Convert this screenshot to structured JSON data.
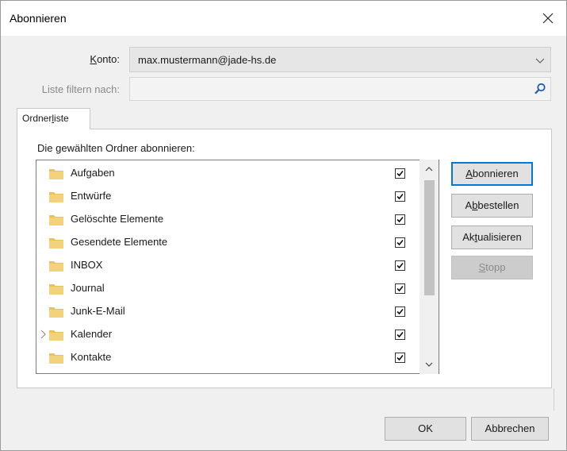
{
  "window": {
    "title": "Abonnieren",
    "close_icon": "close-icon"
  },
  "account": {
    "label_accel": "K",
    "label_rest": "onto:",
    "value": "max.mustermann@jade-hs.de"
  },
  "filter": {
    "label": "Liste filtern nach:",
    "value": "",
    "icon": "search-icon"
  },
  "tab": {
    "label_pre": "Ordner",
    "label_accel": "l",
    "label_post": "iste"
  },
  "folder_list": {
    "caption": "Die gewählten Ordner abonnieren:",
    "items": [
      {
        "name": "Aufgaben",
        "checked": true,
        "expandable": false
      },
      {
        "name": "Entwürfe",
        "checked": true,
        "expandable": false
      },
      {
        "name": "Gelöschte Elemente",
        "checked": true,
        "expandable": false
      },
      {
        "name": "Gesendete Elemente",
        "checked": true,
        "expandable": false
      },
      {
        "name": "INBOX",
        "checked": true,
        "expandable": false
      },
      {
        "name": "Journal",
        "checked": true,
        "expandable": false
      },
      {
        "name": "Junk-E-Mail",
        "checked": true,
        "expandable": false
      },
      {
        "name": "Kalender",
        "checked": true,
        "expandable": true
      },
      {
        "name": "Kontakte",
        "checked": true,
        "expandable": false
      }
    ]
  },
  "side_buttons": {
    "subscribe": {
      "accel": "A",
      "rest": "bonnieren"
    },
    "unsubscribe": {
      "pre": "A",
      "accel": "b",
      "rest": "bestellen"
    },
    "refresh": {
      "pre": "Ak",
      "accel": "t",
      "rest": "ualisieren"
    },
    "stop": {
      "accel": "S",
      "rest": "topp",
      "disabled": true
    }
  },
  "footer": {
    "ok_label": "OK",
    "cancel_label": "Abbrechen"
  },
  "colors": {
    "accent": "#0078d7",
    "folder": "#e8c35a",
    "dialog_bg": "#f0f0f0"
  }
}
